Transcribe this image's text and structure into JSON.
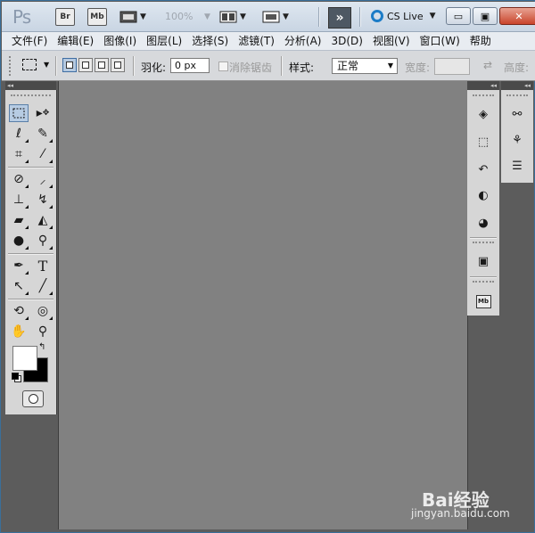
{
  "app": {
    "logo": "Ps",
    "bridge_badge": "Br",
    "minibridge_badge": "Mb",
    "zoom_level": "100%",
    "extend_glyph": "»",
    "cs_live_label": "CS Live",
    "window_minimize": "▭",
    "window_maximize": "▣",
    "window_close": "✕"
  },
  "menu": {
    "items": [
      {
        "label": "文件(F)"
      },
      {
        "label": "编辑(E)"
      },
      {
        "label": "图像(I)"
      },
      {
        "label": "图层(L)"
      },
      {
        "label": "选择(S)"
      },
      {
        "label": "滤镜(T)"
      },
      {
        "label": "分析(A)"
      },
      {
        "label": "3D(D)"
      },
      {
        "label": "视图(V)"
      },
      {
        "label": "窗口(W)"
      },
      {
        "label": "帮助"
      }
    ]
  },
  "options": {
    "feather_label": "羽化:",
    "feather_value": "0 px",
    "antialias_label": "消除锯齿",
    "style_label": "样式:",
    "style_value": "正常",
    "width_label": "宽度:",
    "height_label": "高度:"
  },
  "tools": {
    "header_glyph": "◂◂",
    "icons": [
      "marquee-icon",
      "move-icon",
      "lasso-icon",
      "quick-selection-icon",
      "crop-icon",
      "eyedropper-icon",
      "healing-brush-icon",
      "brush-icon",
      "clone-stamp-icon",
      "history-brush-icon",
      "eraser-icon",
      "paint-bucket-icon",
      "blur-icon",
      "dodge-icon",
      "pen-icon",
      "type-icon",
      "path-selection-icon",
      "line-icon",
      "3d-rotate-icon",
      "3d-orbit-icon",
      "hand-icon",
      "zoom-icon"
    ],
    "type_glyph": "T",
    "foreground_color": "#ffffff",
    "background_color": "#000000"
  },
  "panels": {
    "dock1": [
      "layers-icon",
      "masks-icon",
      "history-icon",
      "adjustments-icon",
      "styles-icon",
      "camera-icon",
      "minibridge-icon"
    ],
    "dock2": [
      "brush-presets-icon",
      "clone-source-icon",
      "paths-icon"
    ],
    "minibridge_label": "Mb",
    "header_glyph": "◂◂"
  },
  "watermark": {
    "brand": "Bai经验",
    "url": "jingyan.baidu.com"
  }
}
